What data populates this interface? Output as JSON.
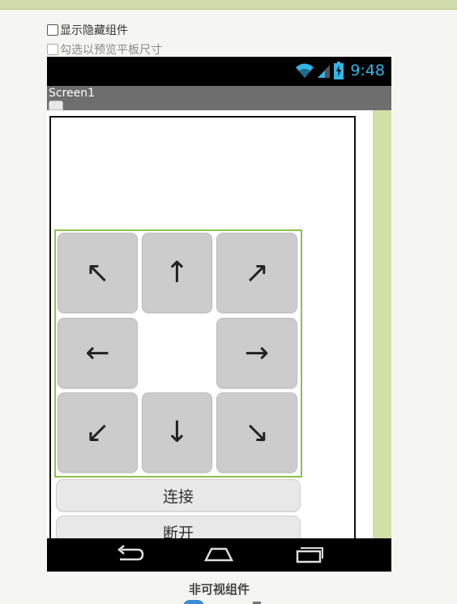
{
  "options": {
    "show_hidden_label": "显示隐藏组件",
    "tablet_preview_label": "勾选以预览平板尺寸"
  },
  "statusbar": {
    "time": "9:48",
    "accent_color": "#33b5e5"
  },
  "screen": {
    "title": "Screen1"
  },
  "pad": {
    "up_left": "↖",
    "up": "↑",
    "up_right": "↗",
    "left": "←",
    "right": "→",
    "down_left": "↙",
    "down": "↓",
    "down_right": "↘",
    "border_color": "#8bc34a"
  },
  "buttons": {
    "connect": "连接",
    "disconnect": "断开"
  },
  "navbar": {
    "icons": [
      "back-icon",
      "home-icon",
      "recent-apps-icon"
    ]
  },
  "footer": {
    "non_visible_label": "非可视组件"
  }
}
